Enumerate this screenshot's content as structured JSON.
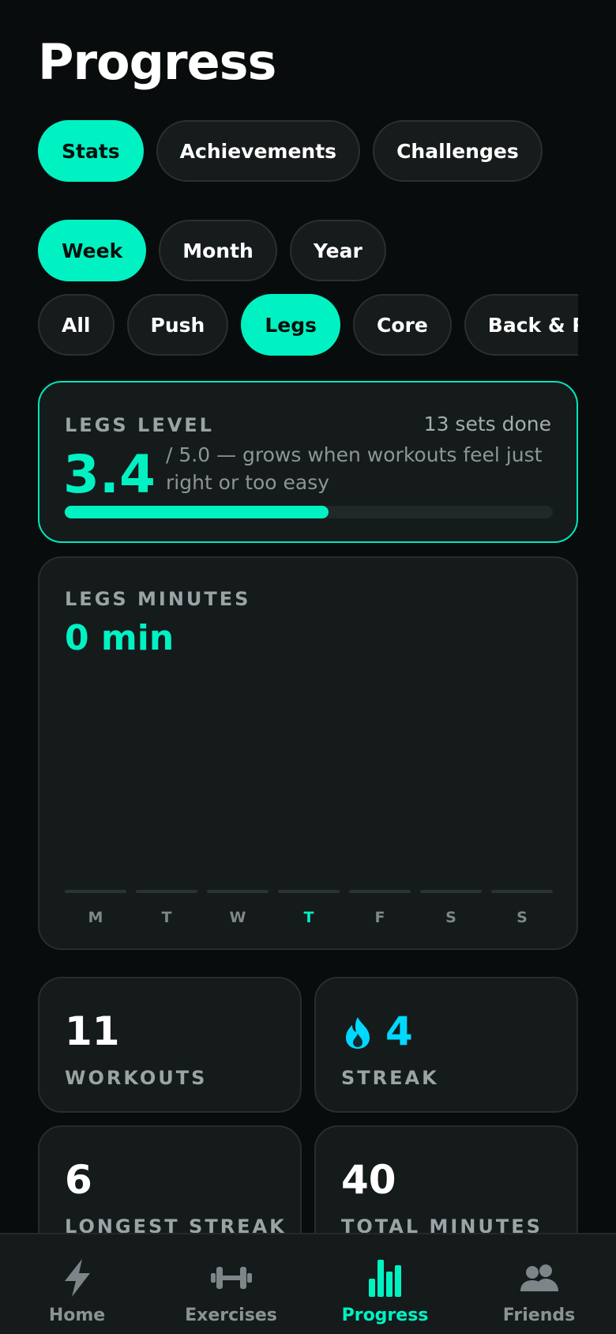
{
  "page": {
    "title": "Progress"
  },
  "tabs": [
    {
      "label": "Stats",
      "active": true
    },
    {
      "label": "Achievements",
      "active": false
    },
    {
      "label": "Challenges",
      "active": false
    }
  ],
  "periods": [
    {
      "label": "Week",
      "active": true
    },
    {
      "label": "Month",
      "active": false
    },
    {
      "label": "Year",
      "active": false
    }
  ],
  "categories": [
    {
      "label": "All",
      "active": false
    },
    {
      "label": "Push",
      "active": false
    },
    {
      "label": "Legs",
      "active": true
    },
    {
      "label": "Core",
      "active": false
    },
    {
      "label": "Back & Posture",
      "active": false
    }
  ],
  "level_card": {
    "label": "LEGS LEVEL",
    "sets": "13 sets done",
    "value": "3.4",
    "description": "/ 5.0 — grows when workouts feel just right or too easy",
    "progress": 0.54
  },
  "minutes_card": {
    "label": "LEGS MINUTES",
    "value": "0 min",
    "days": [
      "M",
      "T",
      "W",
      "T",
      "F",
      "S",
      "S"
    ],
    "minutes": [
      0,
      0,
      0,
      0,
      0,
      0,
      0
    ],
    "today_index": 3
  },
  "stats": {
    "workouts": {
      "value": "11",
      "label": "WORKOUTS"
    },
    "streak": {
      "value": "4",
      "label": "STREAK",
      "icon": "flame-icon"
    },
    "longest": {
      "value": "6",
      "label": "LONGEST STREAK"
    },
    "total": {
      "value": "40",
      "label": "TOTAL MINUTES"
    }
  },
  "nav": [
    {
      "label": "Home",
      "icon": "bolt-icon",
      "active": false
    },
    {
      "label": "Exercises",
      "icon": "dumbbell-icon",
      "active": false
    },
    {
      "label": "Progress",
      "icon": "bar-chart-icon",
      "active": true
    },
    {
      "label": "Friends",
      "icon": "people-icon",
      "active": false
    }
  ],
  "colors": {
    "accent": "#00f2c3",
    "streak": "#00d9ff",
    "background": "#080c0d",
    "card": "#151a1b"
  }
}
